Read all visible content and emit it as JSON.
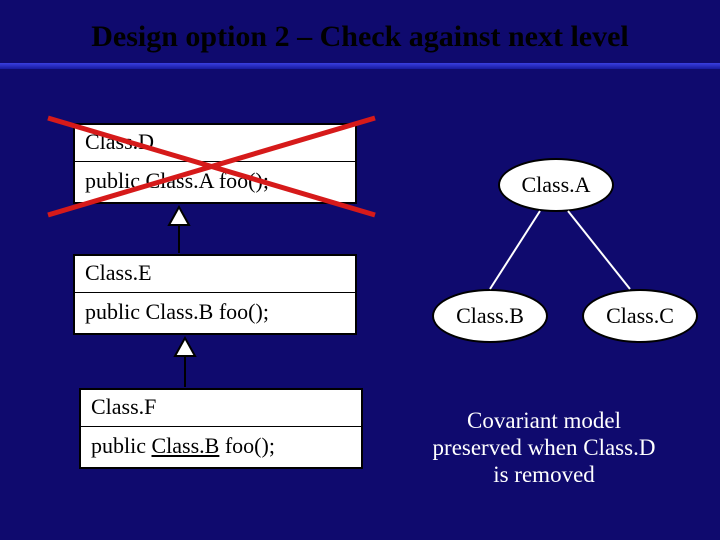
{
  "title": "Design option 2 – Check against next level",
  "uml": {
    "d": {
      "name": "Class.D",
      "method_prefix": "public Class.A foo();"
    },
    "e": {
      "name": "Class.E",
      "method_prefix": "public Class.B foo();"
    },
    "f": {
      "name": "Class.F",
      "method_prefix": "public ",
      "method_return": "Class.B",
      "method_suffix": " foo();"
    }
  },
  "hierarchy": {
    "a": "Class.A",
    "b": "Class.B",
    "c": "Class.C"
  },
  "caption_l1": "Covariant model",
  "caption_l2": "preserved when Class.D",
  "caption_l3": "is removed"
}
